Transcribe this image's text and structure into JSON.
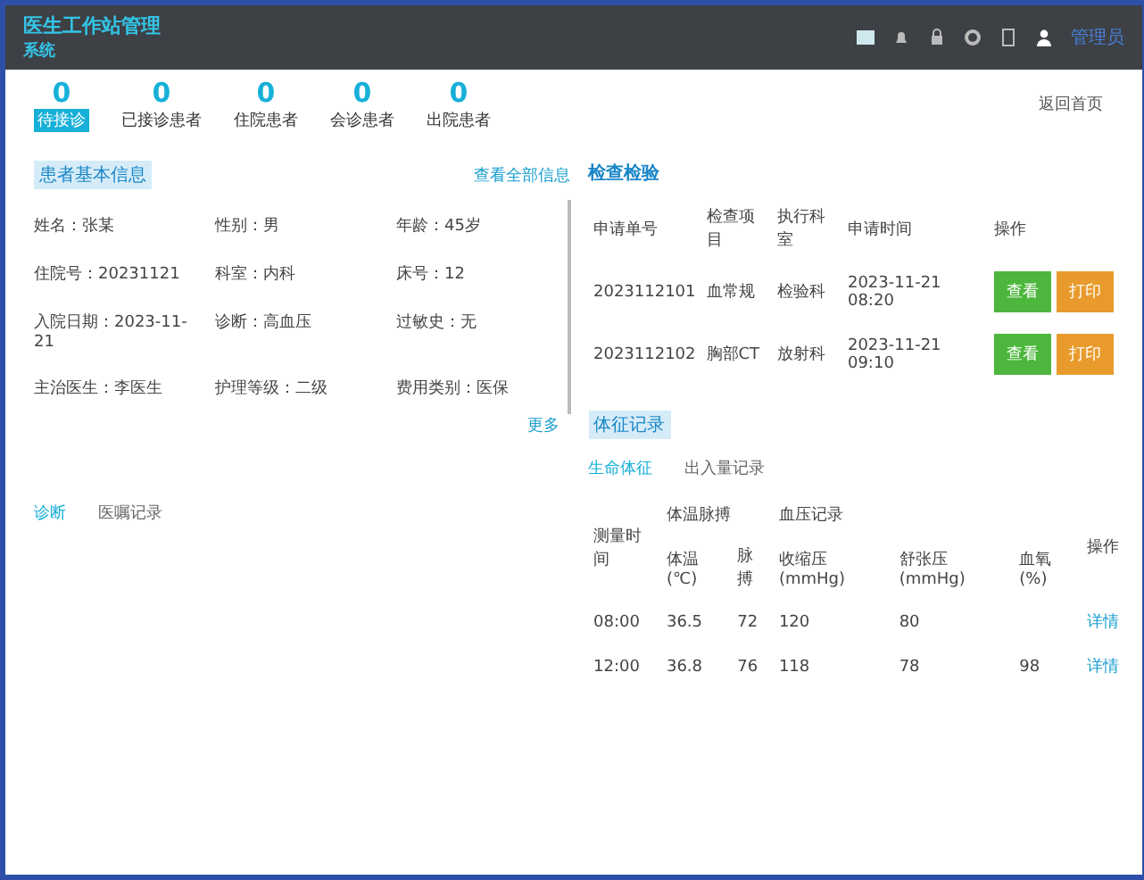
{
  "header": {
    "title": "医生工作站管理",
    "subtitle": "系统",
    "user": "管理员"
  },
  "stats": [
    {
      "value": "0",
      "label": "待接诊",
      "selected": true
    },
    {
      "value": "0",
      "label": "已接诊患者",
      "selected": false
    },
    {
      "value": "0",
      "label": "住院患者",
      "selected": false
    },
    {
      "value": "0",
      "label": "会诊患者",
      "selected": false
    },
    {
      "value": "0",
      "label": "出院患者",
      "selected": false
    }
  ],
  "home_link": "返回首页",
  "patient_panel": {
    "title": "患者基本信息",
    "detail_link": "查看全部信息",
    "more_link": "更多",
    "fields": [
      {
        "label": "姓名：",
        "value": "张某"
      },
      {
        "label": "性别：",
        "value": "男"
      },
      {
        "label": "年龄：",
        "value": "45岁"
      },
      {
        "label": "住院号：",
        "value": "20231121"
      },
      {
        "label": "科室：",
        "value": "内科"
      },
      {
        "label": "床号：",
        "value": "12"
      },
      {
        "label": "入院日期：",
        "value": "2023-11-21"
      },
      {
        "label": "诊断：",
        "value": "高血压"
      },
      {
        "label": "过敏史：",
        "value": "无"
      },
      {
        "label": "主治医生：",
        "value": "李医生"
      },
      {
        "label": "护理等级：",
        "value": "二级"
      },
      {
        "label": "费用类别：",
        "value": "医保"
      }
    ],
    "tabs": [
      {
        "label": "诊断",
        "selected": true
      },
      {
        "label": "医嘱记录",
        "selected": false
      }
    ]
  },
  "exam_panel": {
    "title": "检查检验",
    "columns": [
      "申请单号",
      "检查项目",
      "执行科室",
      "申请时间",
      "操作"
    ],
    "rows": [
      {
        "id": "2023112101",
        "item": "血常规",
        "dept": "检验科",
        "time": "2023-11-21 08:20",
        "actions": [
          "查看",
          "打印"
        ]
      },
      {
        "id": "2023112102",
        "item": "胸部CT",
        "dept": "放射科",
        "time": "2023-11-21 09:10",
        "actions": [
          "查看",
          "打印"
        ]
      }
    ]
  },
  "vitals_panel": {
    "title": "体征记录",
    "tabs": [
      {
        "label": "生命体征",
        "selected": true
      },
      {
        "label": "出入量记录",
        "selected": false
      }
    ],
    "group_headers": [
      "测量时间",
      "体温脉搏",
      "血压记录",
      "操作"
    ],
    "columns": [
      "体温(℃)",
      "脉搏",
      "收缩压(mmHg)",
      "舒张压(mmHg)",
      "血氧(%)"
    ],
    "rows": [
      {
        "time": "08:00",
        "cells": [
          "36.5",
          "72",
          "120",
          "80",
          ""
        ],
        "action": "详情"
      },
      {
        "time": "12:00",
        "cells": [
          "36.8",
          "76",
          "118",
          "78",
          "98"
        ],
        "action": "详情"
      }
    ]
  }
}
